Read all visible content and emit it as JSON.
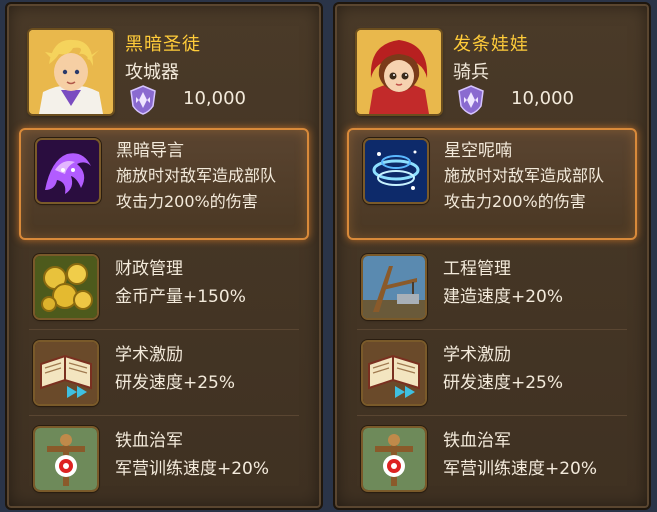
{
  "heroes": [
    {
      "name": "黑暗圣徒",
      "type": "攻城器",
      "power": "10,000",
      "main_skill": {
        "name": "黑暗导言",
        "desc_line1": "施放时对敌军造成部队",
        "desc_line2": "攻击力200%的伤害"
      },
      "skills": [
        {
          "name": "财政管理",
          "desc": "金币产量+150%"
        },
        {
          "name": "学术激励",
          "desc": "研发速度+25%"
        },
        {
          "name": "铁血治军",
          "desc": "军营训练速度+20%"
        }
      ]
    },
    {
      "name": "发条娃娃",
      "type": "骑兵",
      "power": "10,000",
      "main_skill": {
        "name": "星空呢喃",
        "desc_line1": "施放时对敌军造成部队",
        "desc_line2": "攻击力200%的伤害"
      },
      "skills": [
        {
          "name": "工程管理",
          "desc": "建造速度+20%"
        },
        {
          "name": "学术激励",
          "desc": "研发速度+25%"
        },
        {
          "name": "铁血治军",
          "desc": "军营训练速度+20%"
        }
      ]
    }
  ],
  "colors": {
    "name_gold": "#ffcc3a",
    "text": "#f3eadb",
    "panel": "#4a3a28",
    "highlight": "#d98a3a"
  },
  "icons": [
    "dark-sermon-icon",
    "starry-whisper-icon",
    "gold-coins-icon",
    "engineering-icon",
    "book-icon",
    "training-dummy-icon",
    "rank-shield-icon"
  ]
}
